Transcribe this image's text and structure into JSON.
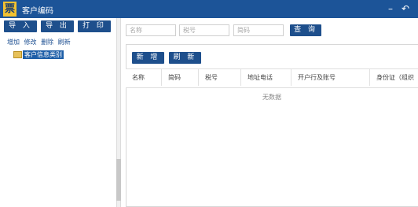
{
  "app": {
    "logo_text": "票",
    "title": "客户编码"
  },
  "window_controls": {
    "minimize": "–",
    "back": "↶"
  },
  "toolbar": {
    "import": "导 入",
    "export": "导 出",
    "print": "打 印"
  },
  "tree_actions": [
    "增加",
    "修改",
    "删除",
    "刷新"
  ],
  "tree": {
    "root_label": "客户信息类别"
  },
  "search": {
    "name_placeholder": "名称",
    "tax_placeholder": "税号",
    "code_placeholder": "简码",
    "query_button": "查 询"
  },
  "grid_actions": {
    "add": "新 增",
    "refresh": "刷 新"
  },
  "table": {
    "columns": [
      "名称",
      "简码",
      "税号",
      "地址电话",
      "开户行及账号",
      "身份证（组织"
    ],
    "empty_text": "无数据"
  }
}
